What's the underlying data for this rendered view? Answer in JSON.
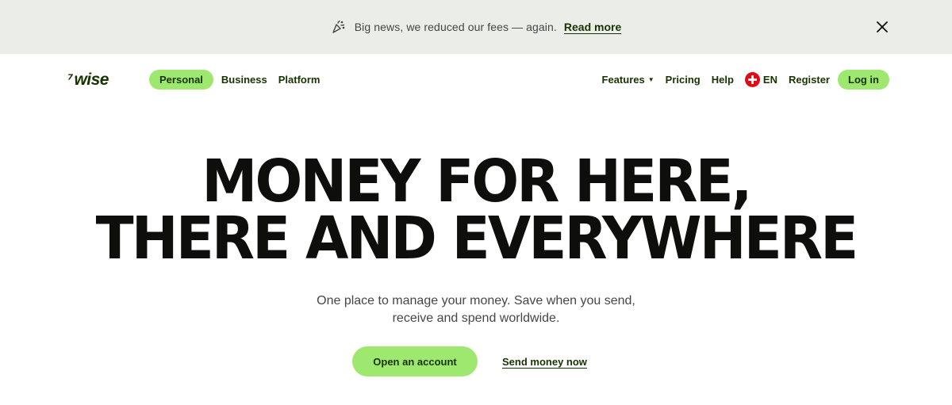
{
  "banner": {
    "icon": "party-popper-icon",
    "message": "Big news, we reduced our fees — again.",
    "link_label": "Read more",
    "close_icon": "close-icon"
  },
  "nav": {
    "logo": {
      "arrow": "⁷",
      "text": "wise"
    },
    "segments": [
      {
        "label": "Personal",
        "active": true
      },
      {
        "label": "Business",
        "active": false
      },
      {
        "label": "Platform",
        "active": false
      }
    ],
    "features": "Features",
    "pricing": "Pricing",
    "help": "Help",
    "language": {
      "flag_icon": "swiss-flag-icon",
      "label": "EN"
    },
    "register": "Register",
    "login": "Log in"
  },
  "hero": {
    "title_line1": "MONEY FOR HERE,",
    "title_line2": "THERE AND EVERYWHERE",
    "subtitle_line1": "One place to manage your money. Save when you send,",
    "subtitle_line2": "receive and spend worldwide.",
    "primary_cta": "Open an account",
    "secondary_cta": "Send money now"
  },
  "colors": {
    "brand_green": "#9fe870",
    "forest_green": "#163300",
    "banner_bg": "#ebede8",
    "text_dark": "#0e0f0c"
  }
}
